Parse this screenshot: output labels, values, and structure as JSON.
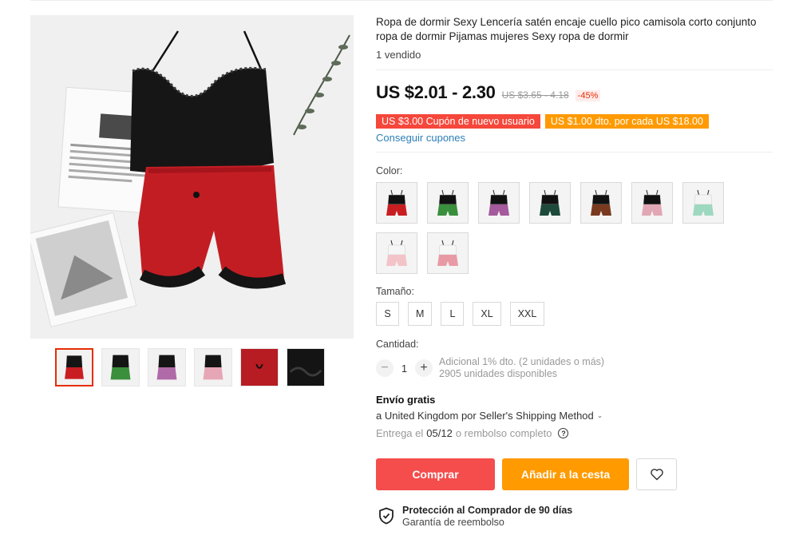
{
  "product": {
    "title": "Ropa de dormir Sexy Lencería satén encaje cuello pico camisola corto conjunto ropa de dormir Pijamas mujeres Sexy ropa de dormir",
    "sold": "1 vendido"
  },
  "gallery": {
    "main_image": "black-lace-cami-red-satin-shorts",
    "thumbnails": [
      {
        "name": "thumb-red",
        "active": true
      },
      {
        "name": "thumb-green",
        "active": false
      },
      {
        "name": "thumb-purple",
        "active": false
      },
      {
        "name": "thumb-pink",
        "active": false
      },
      {
        "name": "thumb-red-closeup",
        "active": false
      },
      {
        "name": "thumb-black-lace-closeup",
        "active": false
      }
    ]
  },
  "pricing": {
    "price": "US $2.01 - 2.30",
    "old_price": "US $3.65 - 4.18",
    "discount": "-45%",
    "coupon_new_user": "US $3.00 Cupón de nuevo usuario",
    "coupon_bulk": "US $1.00 dto. por cada US $18.00",
    "get_coupons": "Conseguir cupones",
    "colors": {
      "coupon_red": "#f5473b",
      "coupon_orange": "#ff9a00",
      "accent": "#e62e04"
    }
  },
  "variants": {
    "color_label": "Color:",
    "colors": [
      {
        "top": "#111111",
        "bottom": "#c81e22"
      },
      {
        "top": "#111111",
        "bottom": "#3a8f3c"
      },
      {
        "top": "#111111",
        "bottom": "#a45a9c"
      },
      {
        "top": "#111111",
        "bottom": "#1d4a3a"
      },
      {
        "top": "#111111",
        "bottom": "#7a3a20"
      },
      {
        "top": "#111111",
        "bottom": "#e2a7b4"
      },
      {
        "top": "#f4f4f4",
        "bottom": "#9ed8c0"
      },
      {
        "top": "#f6f6f6",
        "bottom": "#f2c4c8"
      },
      {
        "top": "#f6f6f6",
        "bottom": "#e89aa4"
      }
    ],
    "size_label": "Tamaño:",
    "sizes": [
      "S",
      "M",
      "L",
      "XL",
      "XXL"
    ]
  },
  "quantity": {
    "label": "Cantidad:",
    "minus": "−",
    "value": "1",
    "plus": "+",
    "bulk_discount": "Adicional 1% dto. (2 unidades o más)",
    "available": "2905 unidades disponibles"
  },
  "shipping": {
    "title": "Envío gratis",
    "method": "a United Kingdom por Seller's Shipping Method",
    "delivery_prefix": "Entrega el",
    "delivery_date": "05/12",
    "delivery_suffix": "o rembolso completo"
  },
  "actions": {
    "buy": "Comprar",
    "add_to_cart": "Añadir a la cesta"
  },
  "protection": {
    "title": "Protección al Comprador de 90 días",
    "subtitle": "Garantía de reembolso"
  }
}
